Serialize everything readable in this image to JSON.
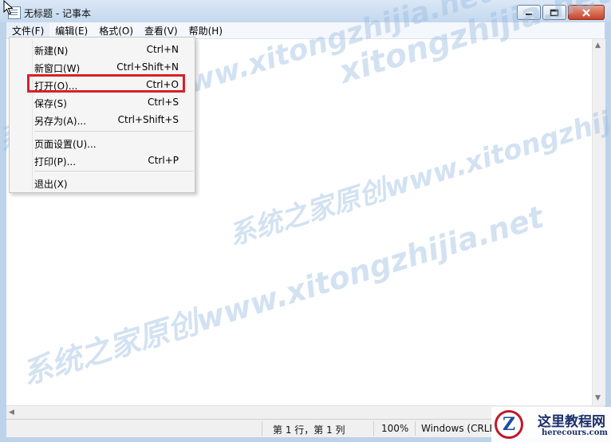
{
  "window": {
    "title": "无标题 - 记事本"
  },
  "menubar": {
    "items": [
      "文件(F)",
      "编辑(E)",
      "格式(O)",
      "查看(V)",
      "帮助(H)"
    ]
  },
  "file_menu": {
    "items": [
      {
        "label": "新建(N)",
        "shortcut": "Ctrl+N"
      },
      {
        "label": "新窗口(W)",
        "shortcut": "Ctrl+Shift+N"
      },
      {
        "label": "打开(O)...",
        "shortcut": "Ctrl+O",
        "highlighted": true
      },
      {
        "label": "保存(S)",
        "shortcut": "Ctrl+S"
      },
      {
        "label": "另存为(A)...",
        "shortcut": "Ctrl+Shift+S"
      },
      {
        "label": "页面设置(U)...",
        "shortcut": ""
      },
      {
        "label": "打印(P)...",
        "shortcut": "Ctrl+P"
      },
      {
        "label": "退出(X)",
        "shortcut": ""
      }
    ],
    "highlight_color": "#d8202a"
  },
  "statusbar": {
    "position": "第 1 行，第 1 列",
    "zoom": "100%",
    "encoding": "Windows (CRLF)"
  },
  "watermarks": [
    "xitongzhijia.net",
    "系统之家原创www.xitongzhijia.net",
    "系统之家原创www.xitongzhijia.net",
    "系统之家原创www.xitongzhijia.net"
  ],
  "logo": {
    "cn": "这里教程网",
    "en": "herecours.com",
    "mark": "Z"
  }
}
